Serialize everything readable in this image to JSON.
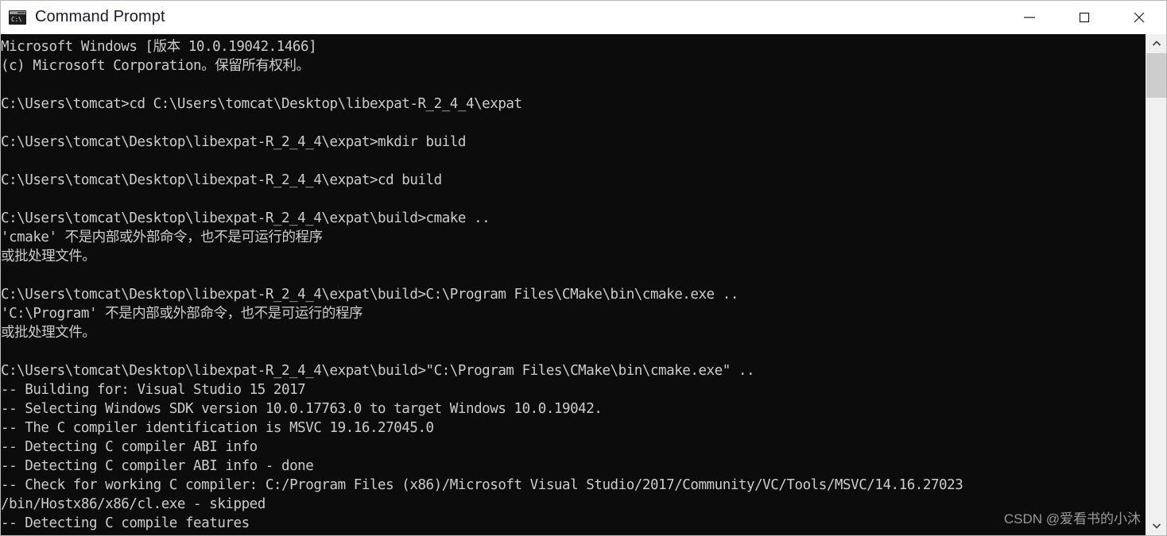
{
  "window": {
    "title": "Command Prompt",
    "icon": "cmd-prompt-icon",
    "icon_glyph": "C:\\",
    "colors": {
      "titlebar_bg": "#ffffff",
      "title_fg": "#1a1a2e",
      "terminal_bg": "#0c0c0c",
      "terminal_fg": "#cccccc",
      "scrollbar_track": "#f0f0f0",
      "scrollbar_thumb": "#cdcdcd"
    },
    "controls": [
      {
        "name": "minimize",
        "label": "Minimize"
      },
      {
        "name": "maximize",
        "label": "Maximize"
      },
      {
        "name": "close",
        "label": "Close"
      }
    ]
  },
  "terminal": {
    "content": "Microsoft Windows [版本 10.0.19042.1466]\n(c) Microsoft Corporation。保留所有权利。\n\nC:\\Users\\tomcat>cd C:\\Users\\tomcat\\Desktop\\libexpat-R_2_4_4\\expat\n\nC:\\Users\\tomcat\\Desktop\\libexpat-R_2_4_4\\expat>mkdir build\n\nC:\\Users\\tomcat\\Desktop\\libexpat-R_2_4_4\\expat>cd build\n\nC:\\Users\\tomcat\\Desktop\\libexpat-R_2_4_4\\expat\\build>cmake ..\n'cmake' 不是内部或外部命令，也不是可运行的程序\n或批处理文件。\n\nC:\\Users\\tomcat\\Desktop\\libexpat-R_2_4_4\\expat\\build>C:\\Program Files\\CMake\\bin\\cmake.exe ..\n'C:\\Program' 不是内部或外部命令，也不是可运行的程序\n或批处理文件。\n\nC:\\Users\\tomcat\\Desktop\\libexpat-R_2_4_4\\expat\\build>\"C:\\Program Files\\CMake\\bin\\cmake.exe\" ..\n-- Building for: Visual Studio 15 2017\n-- Selecting Windows SDK version 10.0.17763.0 to target Windows 10.0.19042.\n-- The C compiler identification is MSVC 19.16.27045.0\n-- Detecting C compiler ABI info\n-- Detecting C compiler ABI info - done\n-- Check for working C compiler: C:/Program Files (x86)/Microsoft Visual Studio/2017/Community/VC/Tools/MSVC/14.16.27023\n/bin/Hostx86/x86/cl.exe - skipped\n-- Detecting C compile features",
    "lines": [
      "Microsoft Windows [版本 10.0.19042.1466]",
      "(c) Microsoft Corporation。保留所有权利。",
      "",
      "C:\\Users\\tomcat>cd C:\\Users\\tomcat\\Desktop\\libexpat-R_2_4_4\\expat",
      "",
      "C:\\Users\\tomcat\\Desktop\\libexpat-R_2_4_4\\expat>mkdir build",
      "",
      "C:\\Users\\tomcat\\Desktop\\libexpat-R_2_4_4\\expat>cd build",
      "",
      "C:\\Users\\tomcat\\Desktop\\libexpat-R_2_4_4\\expat\\build>cmake ..",
      "'cmake' 不是内部或外部命令，也不是可运行的程序",
      "或批处理文件。",
      "",
      "C:\\Users\\tomcat\\Desktop\\libexpat-R_2_4_4\\expat\\build>C:\\Program Files\\CMake\\bin\\cmake.exe ..",
      "'C:\\Program' 不是内部或外部命令，也不是可运行的程序",
      "或批处理文件。",
      "",
      "C:\\Users\\tomcat\\Desktop\\libexpat-R_2_4_4\\expat\\build>\"C:\\Program Files\\CMake\\bin\\cmake.exe\" ..",
      "-- Building for: Visual Studio 15 2017",
      "-- Selecting Windows SDK version 10.0.17763.0 to target Windows 10.0.19042.",
      "-- The C compiler identification is MSVC 19.16.27045.0",
      "-- Detecting C compiler ABI info",
      "-- Detecting C compiler ABI info - done",
      "-- Check for working C compiler: C:/Program Files (x86)/Microsoft Visual Studio/2017/Community/VC/Tools/MSVC/14.16.27023",
      "/bin/Hostx86/x86/cl.exe - skipped",
      "-- Detecting C compile features"
    ]
  },
  "watermark": {
    "text": "CSDN @爱看书的小沐"
  },
  "scrollbar": {
    "up_arrow": "chevron-up-icon",
    "down_arrow": "chevron-down-icon",
    "thumb_position_percent": 0
  }
}
